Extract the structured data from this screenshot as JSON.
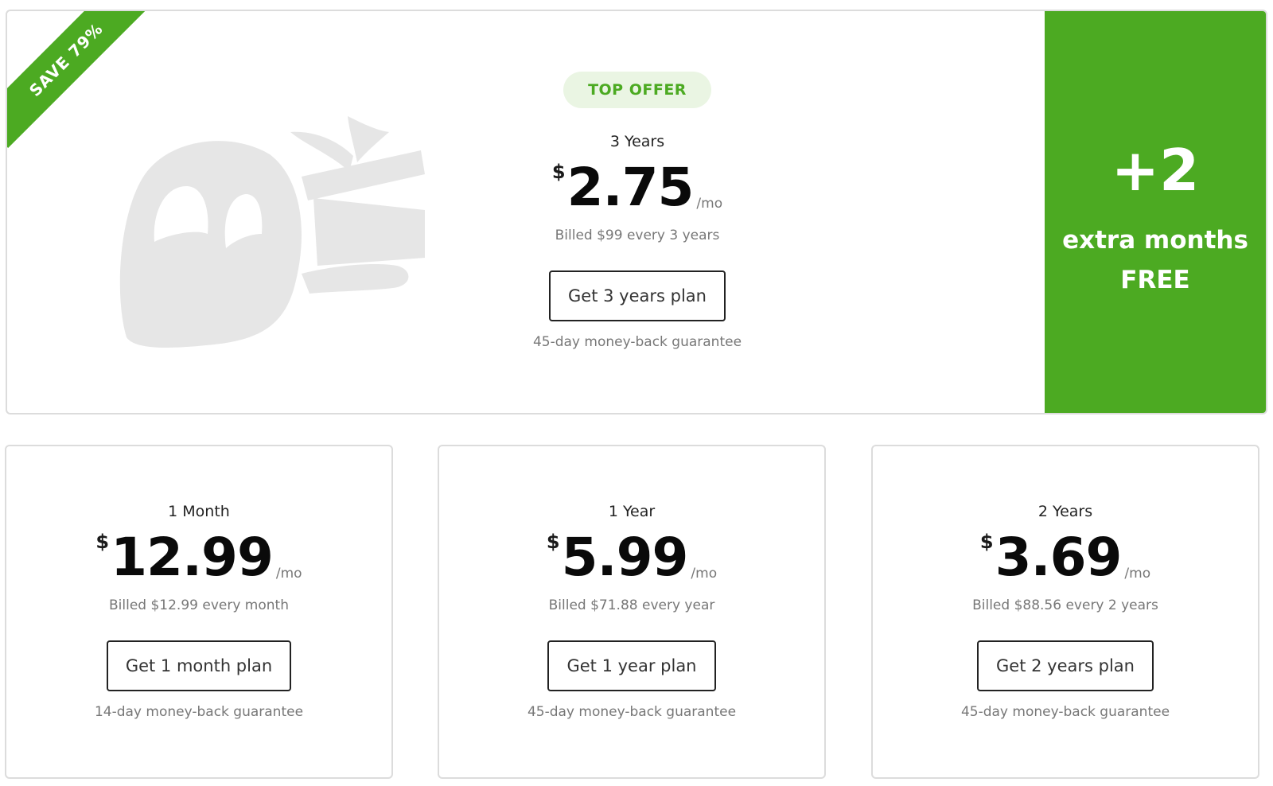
{
  "top_offer": {
    "ribbon": "SAVE 79%",
    "badge": "TOP OFFER",
    "plan_label": "3 Years",
    "currency": "$",
    "amount": "2.75",
    "per": "/mo",
    "billed": "Billed $99 every 3 years",
    "cta": "Get 3 years plan",
    "guarantee": "45-day money-back guarantee",
    "extra": {
      "plus": "+2",
      "line1": "extra months",
      "line2": "FREE"
    },
    "mascot_icon": "ghost-with-gift-icon"
  },
  "plans": [
    {
      "plan_label": "1 Month",
      "currency": "$",
      "amount": "12.99",
      "per": "/mo",
      "billed": "Billed $12.99 every month",
      "cta": "Get 1 month plan",
      "guarantee": "14-day money-back guarantee"
    },
    {
      "plan_label": "1 Year",
      "currency": "$",
      "amount": "5.99",
      "per": "/mo",
      "billed": "Billed $71.88 every year",
      "cta": "Get 1 year plan",
      "guarantee": "45-day money-back guarantee"
    },
    {
      "plan_label": "2 Years",
      "currency": "$",
      "amount": "3.69",
      "per": "/mo",
      "billed": "Billed $88.56 every 2 years",
      "cta": "Get 2 years plan",
      "guarantee": "45-day money-back guarantee"
    }
  ],
  "colors": {
    "brand_green": "#4caa22",
    "badge_bg": "#eaf5e3",
    "ghost_gray": "#e6e6e6",
    "border": "#dcdcdc"
  }
}
